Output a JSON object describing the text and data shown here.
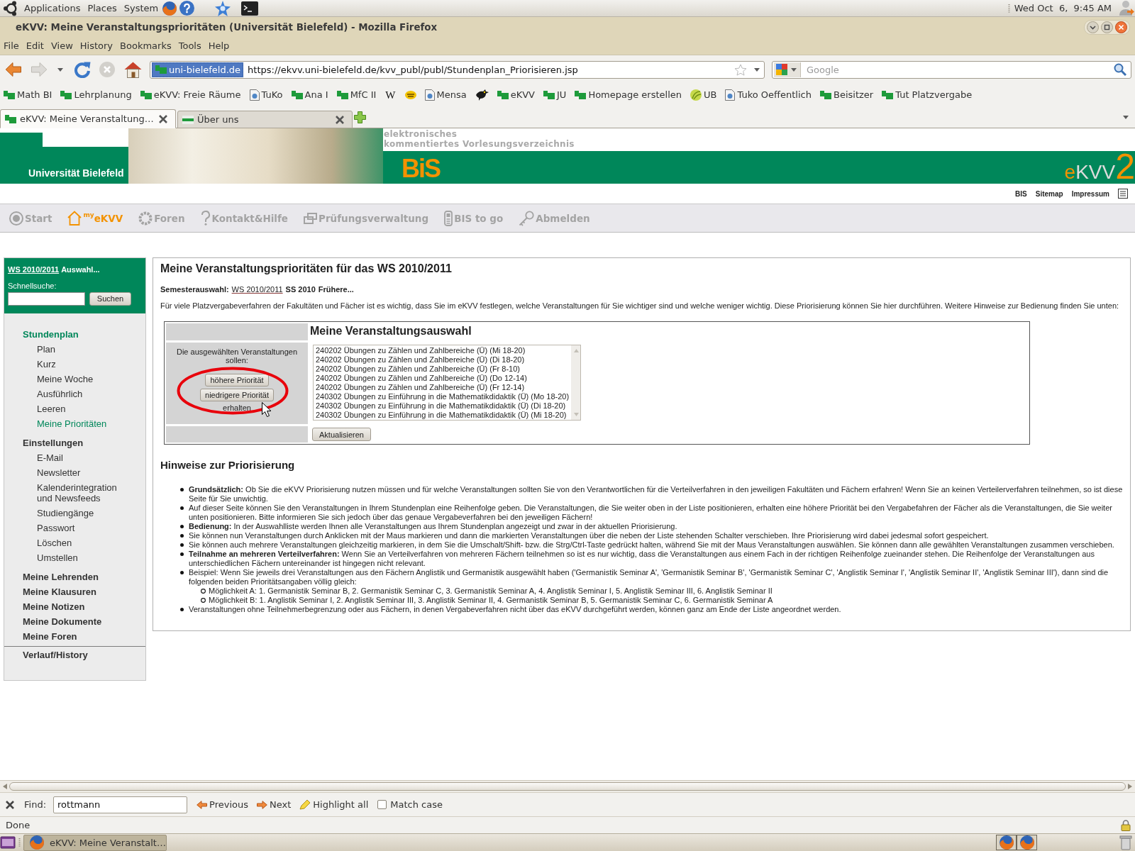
{
  "top_panel": {
    "menus": [
      "Applications",
      "Places",
      "System"
    ],
    "clock": "Wed Oct  6,  9:45 AM"
  },
  "window": {
    "title": "eKVV: Meine Veranstaltungsprioritäten (Universität Bielefeld) - Mozilla Firefox"
  },
  "menu_bar": [
    "File",
    "Edit",
    "View",
    "History",
    "Bookmarks",
    "Tools",
    "Help"
  ],
  "navigation": {
    "site_identity": "uni-bielefeld.de",
    "url": "https://ekvv.uni-bielefeld.de/kvv_publ/publ/Stundenplan_Priorisieren.jsp",
    "search_placeholder": "Google"
  },
  "bookmarks": [
    {
      "kind": "flag",
      "label": "Math BI"
    },
    {
      "kind": "flag",
      "label": "Lehrplanung"
    },
    {
      "kind": "flag",
      "label": "eKVV: Freie Räume"
    },
    {
      "kind": "page",
      "label": "TuKo"
    },
    {
      "kind": "flag",
      "label": "Ana I"
    },
    {
      "kind": "flag",
      "label": "MfC II"
    },
    {
      "kind": "letter",
      "glyph": "W"
    },
    {
      "kind": "emblem"
    },
    {
      "kind": "page",
      "label": "Mensa"
    },
    {
      "kind": "bird"
    },
    {
      "kind": "flag",
      "label": "eKVV"
    },
    {
      "kind": "flag",
      "label": "JU"
    },
    {
      "kind": "flag",
      "label": "Homepage erstellen"
    },
    {
      "kind": "leaf",
      "label": "UB"
    },
    {
      "kind": "page",
      "label": "Tuko Oeffentlich"
    },
    {
      "kind": "flag",
      "label": "Beisitzer"
    },
    {
      "kind": "flag",
      "label": "Tut Platzvergabe"
    }
  ],
  "tabs": [
    {
      "kind": "flag",
      "label": "eKVV: Meine Veranstaltung…",
      "selected": true
    },
    {
      "kind": "banner",
      "label": "Über uns",
      "selected": false
    }
  ],
  "page": {
    "header": {
      "university": "Universität Bielefeld",
      "tagline": [
        "elektronisches",
        "kommentiertes Vorlesungsverzeichnis"
      ],
      "bis_logo": "BiS",
      "ekvv_logo": {
        "prefix": "e",
        "name": "KVV",
        "version": "2"
      }
    },
    "top_links": [
      "BIS",
      "Sitemap",
      "Impressum"
    ],
    "main_nav": [
      {
        "kind": "circle",
        "label": "Start",
        "selected": false
      },
      {
        "kind": "house",
        "label": "$^{my}$eKVV",
        "selected": true
      },
      {
        "kind": "ring",
        "label": "Foren",
        "selected": false
      },
      {
        "kind": "question",
        "label": "Kontakt&Hilfe",
        "selected": false
      },
      {
        "kind": "windows",
        "label": "Prüfungsverwaltung",
        "selected": false
      },
      {
        "kind": "phone",
        "label": "BIS to go",
        "selected": false
      },
      {
        "kind": "key",
        "label": "Abmelden",
        "selected": false
      }
    ],
    "sidebar": {
      "semester_link": "WS 2010/2011",
      "semester_more": "Auswahl...",
      "search_label": "Schnellsuche:",
      "search_button": "Suchen",
      "sections": [
        {
          "label": "Stundenplan",
          "selected": true,
          "children": [
            {
              "label": "Plan",
              "selected": false
            },
            {
              "label": "Kurz",
              "selected": false
            },
            {
              "label": "Meine Woche",
              "selected": false
            },
            {
              "label": "Ausführlich",
              "selected": false
            },
            {
              "label": "Leeren",
              "selected": false
            },
            {
              "label": "Meine Prioritäten",
              "selected": true
            }
          ]
        },
        {
          "label": "Einstellungen",
          "selected": false,
          "children": [
            {
              "label": "E-Mail",
              "selected": false
            },
            {
              "label": "Newsletter",
              "selected": false
            },
            {
              "label": "Kalenderintegration und Newsfeeds",
              "selected": false
            },
            {
              "label": "Studiengänge",
              "selected": false
            },
            {
              "label": "Passwort",
              "selected": false
            },
            {
              "label": "Löschen",
              "selected": false
            },
            {
              "label": "Umstellen",
              "selected": false
            }
          ]
        },
        {
          "label": "Meine Lehrenden",
          "selected": false
        },
        {
          "label": "Meine Klausuren",
          "selected": false
        },
        {
          "label": "Meine Notizen",
          "selected": false
        },
        {
          "label": "Meine Dokumente",
          "selected": false
        },
        {
          "label": "Meine Foren",
          "selected": false
        }
      ],
      "history_link": "Verlauf/History"
    },
    "content": {
      "title": "Meine Veranstaltungsprioritäten für das WS 2010/2011",
      "semester_label": "Semesterauswahl:",
      "semesters": [
        {
          "label": "WS 2010/2011",
          "selected": true
        },
        {
          "label": "SS 2010",
          "selected": false
        },
        {
          "label": "Frühere...",
          "selected": false
        }
      ],
      "intro": "Für viele Platzvergabeverfahren der Fakultäten und Fächer ist es wichtig, dass Sie im eKVV festlegen, welche Veranstaltungen für Sie wichtiger sind und welche weniger wichtig. Diese Priorisierung können Sie hier durchführen. Weitere Hinweise zur Bedienung finden Sie unten:",
      "priority_box": {
        "title": "Meine Veranstaltungsauswahl",
        "instruction": "Die ausgewählten Veranstaltungen sollen:",
        "buttons": [
          "höhere Priorität",
          "niedrigere Priorität"
        ],
        "instruction_end": "erhalten",
        "courses": [
          {
            "label": "240202 Übungen zu Zählen und Zahlbereiche (Ü) (Mi 18-20)",
            "selected": false
          },
          {
            "label": "240202 Übungen zu Zählen und Zahlbereiche (Ü) (Di 18-20)",
            "selected": false
          },
          {
            "label": "240202 Übungen zu Zählen und Zahlbereiche (Ü) (Fr 8-10)",
            "selected": false
          },
          {
            "label": "240202 Übungen zu Zählen und Zahlbereiche (Ü) (Do 12-14)",
            "selected": false
          },
          {
            "label": "240202 Übungen zu Zählen und Zahlbereiche (Ü) (Fr 12-14)",
            "selected": false
          },
          {
            "label": "240302 Übungen zu Einführung in die Mathematikdidaktik (Ü) (Mo 18-20)",
            "selected": false
          },
          {
            "label": "240302 Übungen zu Einführung in die Mathematikdidaktik (Ü) (Di 18-20)",
            "selected": false
          },
          {
            "label": "240302 Übungen zu Einführung in die Mathematikdidaktik (Ü) (Mi 18-20)",
            "selected": false
          }
        ],
        "submit": "Aktualisieren"
      },
      "hints_title": "Hinweise zur Priorisierung",
      "hints": [
        {
          "text": "**Grundsätzlich:** Ob Sie die eKVV Priorisierung nutzen müssen und für welche Veranstaltungen sollten Sie von den Verantwortlichen für die Verteilverfahren in den jeweiligen Fakultäten und Fächern erfahren! Wenn Sie an keinen Verteilerverfahren teilnehmen, so ist diese Seite für Sie unwichtig."
        },
        {
          "text": "Auf dieser Seite können Sie den Veranstaltungen in Ihrem Stundenplan eine Reihenfolge geben. Die Veranstaltungen, die Sie weiter oben in der Liste positionieren, erhalten eine höhere Priorität bei den Vergabefahren der Fächer als die Veranstaltungen, die Sie weiter unten positionieren. Bitte informieren Sie sich jedoch über das genaue Vergabeverfahren bei den jeweiligen Fächern!"
        },
        {
          "text": "**Bedienung:** In der Auswahlliste werden Ihnen alle Veranstaltungen aus Ihrem Stundenplan angezeigt und zwar in der aktuellen Priorisierung."
        },
        {
          "text": "Sie können nun Veranstaltungen durch Anklicken mit der Maus markieren und dann die markierten Veranstaltungen über die neben der Liste stehenden Schalter verschieben. Ihre Priorisierung wird dabei jedesmal sofort gespeichert."
        },
        {
          "text": "Sie können auch mehrere Veranstaltungen gleichzeitig markieren, in dem Sie die Umschalt/Shift- bzw. die Strg/Ctrl-Taste gedrückt halten, während Sie mit der Maus Veranstaltungen auswählen. Sie können dann alle gewählten Veranstaltungen zusammen verschieben."
        },
        {
          "text": "**Teilnahme an mehreren Verteilverfahren:** Wenn Sie an Verteilverfahren von mehreren Fächern teilnehmen so ist es nur wichtig, dass die Veranstaltungen aus einem Fach in der richtigen Reihenfolge zueinander stehen. Die Reihenfolge der Veranstaltungen aus unterschiedlichen Fächern untereinander ist hingegen nicht relevant."
        },
        {
          "text": "Beispiel: Wenn Sie jeweils drei Veranstaltungen aus den Fächern Anglistik und Germanistik ausgewählt haben ('Germanistik Seminar A', 'Germanistik Seminar B', 'Germanistik Seminar C', 'Anglistik Seminar I', 'Anglistik Seminar II', 'Anglistik Seminar III'), dann sind die folgenden beiden Prioritätsangaben völlig gleich:",
          "children": [
            {
              "text": "Möglichkeit A: 1. Germanistik Seminar B, 2. Germanistik Seminar C, 3. Germanistik Seminar A, 4. Anglistik Seminar I, 5. Anglistik Seminar III, 6. Anglistik Seminar II"
            },
            {
              "text": "Möglichkeit B: 1. Anglistik Seminar I, 2. Anglistik Seminar III, 3. Anglistik Seminar II, 4. Germanistik Seminar B, 5. Germanistik Seminar C, 6. Germanistik Seminar A"
            }
          ]
        },
        {
          "text": "Veranstaltungen ohne Teilnehmerbegrenzung oder aus Fächern, in denen Vergabeverfahren nicht über das eKVV durchgeführt werden, können ganz am Ende der Liste angeordnet werden."
        }
      ]
    }
  },
  "find_bar": {
    "label": "Find:",
    "value": "rottmann",
    "buttons": [
      {
        "kind": "previous",
        "label": "Previous"
      },
      {
        "kind": "next",
        "label": "Next"
      },
      {
        "kind": "highlight",
        "label": "Highlight all"
      }
    ],
    "match_case": {
      "label": "Match case",
      "checked": false
    }
  },
  "status_bar": {
    "text": "Done"
  },
  "taskbar": {
    "windows": [
      {
        "label": "eKVV: Meine Veranstalt…",
        "selected": true
      }
    ]
  }
}
